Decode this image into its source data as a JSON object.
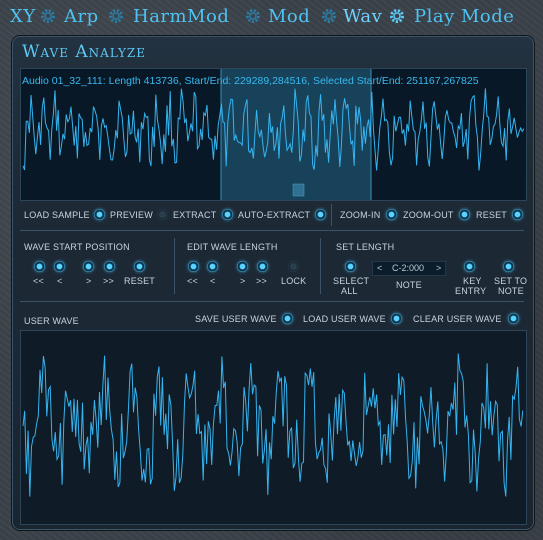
{
  "nav": {
    "items": [
      "XY",
      "Arp",
      "HarmMod",
      "Mod",
      "Wav",
      "Play Mode"
    ],
    "active": "Wav"
  },
  "panel": {
    "title": "Wave Analyze",
    "info": "Audio 01_32_111: Length 413736, Start/End: 229289,284516, Selected Start/End: 251167,267825"
  },
  "controls_row1": {
    "load_sample": "LOAD SAMPLE",
    "preview": "PREVIEW",
    "extract": "EXTRACT",
    "auto_extract": "AUTO-EXTRACT",
    "zoom_in": "ZOOM-IN",
    "zoom_out": "ZOOM-OUT",
    "reset": "RESET"
  },
  "wave_start": {
    "title": "WAVE START POSITION",
    "b1": "<<",
    "b2": "<",
    "b3": ">",
    "b4": ">>",
    "b5": "RESET"
  },
  "edit_length": {
    "title": "EDIT WAVE LENGTH",
    "b1": "<<",
    "b2": "<",
    "b3": ">",
    "b4": ">>",
    "b5": "LOCK"
  },
  "set_length": {
    "title": "SET LENGTH",
    "select_all_1": "SELECT",
    "select_all_2": "ALL",
    "note_prev": "<",
    "note_value": "C-2:000",
    "note_next": ">",
    "note_label": "NOTE",
    "key_entry_1": "KEY",
    "key_entry_2": "ENTRY",
    "set_to_note_1": "SET TO",
    "set_to_note_2": "NOTE"
  },
  "user_wave": {
    "title": "USER WAVE",
    "save": "SAVE USER WAVE",
    "load": "LOAD USER WAVE",
    "clear": "CLEAR USER WAVE"
  },
  "colors": {
    "accent": "#39b9f0",
    "wave": "#35b4f0",
    "selection": "#1c4d66",
    "background": "#3b4249"
  }
}
